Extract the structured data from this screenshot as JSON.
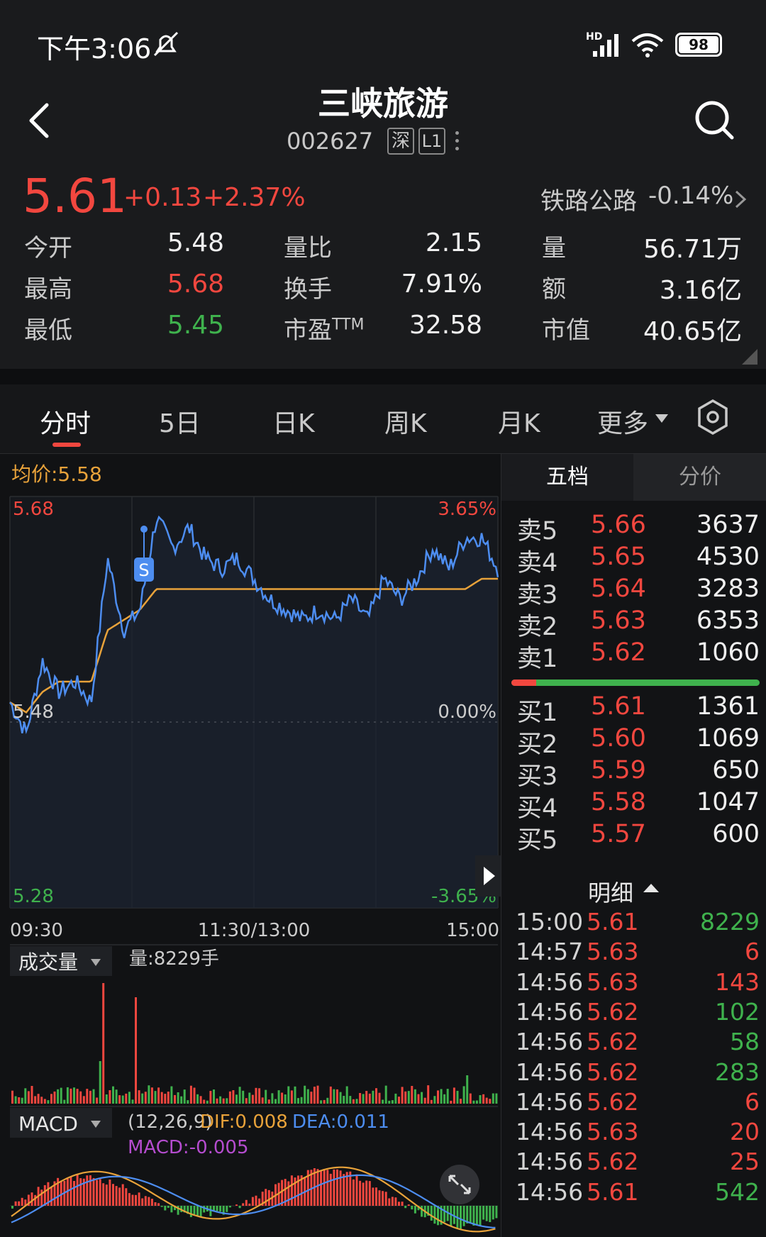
{
  "status": {
    "time": "下午3:06",
    "battery": "98",
    "network": "HD"
  },
  "stock": {
    "name": "三峡旅游",
    "code": "002627",
    "market": "深",
    "level": "L1",
    "price": "5.61",
    "change": "+0.13",
    "change_pct": "+2.37%",
    "sector": "铁路公路",
    "sector_pct": "-0.14%"
  },
  "stats": {
    "open_label": "今开",
    "open": "5.48",
    "high_label": "最高",
    "high": "5.68",
    "low_label": "最低",
    "low": "5.45",
    "vr_label": "量比",
    "vr": "2.15",
    "turn_label": "换手",
    "turn": "7.91%",
    "pe_label": "市盈",
    "pe_sup": "TTM",
    "pe": "32.58",
    "vol_label": "量",
    "vol": "56.71万",
    "amt_label": "额",
    "amt": "3.16亿",
    "mcap_label": "市值",
    "mcap": "40.65亿"
  },
  "tabs": [
    "分时",
    "5日",
    "日K",
    "周K",
    "月K",
    "更多"
  ],
  "chart": {
    "avg_label": "均价:5.58",
    "y_top": "5.68",
    "y_mid": "5.48",
    "y_bot": "5.28",
    "pct_top": "3.65%",
    "pct_mid": "0.00%",
    "pct_bot": "-3.65%",
    "x_start": "09:30",
    "x_mid": "11:30/13:00",
    "x_end": "15:00",
    "marker": "S",
    "vol_selector": "成交量",
    "vol_info": "量:8229手",
    "macd_selector": "MACD",
    "macd_params": "(12,26,9)",
    "dif": "DIF:0.008",
    "dea": "DEA:0.011",
    "macd": "MACD:-0.005"
  },
  "chart_data": {
    "type": "line",
    "title": "",
    "x": [
      "09:30",
      "11:30/13:00",
      "15:00"
    ],
    "ylim": [
      5.28,
      5.68
    ],
    "series": [
      {
        "name": "",
        "values": [
          5.48,
          5.45,
          5.52,
          5.49,
          5.5,
          5.48,
          5.62,
          5.55,
          5.57,
          5.66,
          5.63,
          5.65,
          5.62,
          5.61,
          5.62,
          5.6,
          5.58,
          5.57,
          5.56,
          5.57,
          5.56,
          5.58,
          5.56,
          5.6,
          5.58,
          5.6,
          5.63,
          5.61,
          5.64,
          5.64,
          5.61
        ]
      },
      {
        "name": "均价",
        "values": [
          5.48,
          5.47,
          5.49,
          5.5,
          5.5,
          5.5,
          5.55,
          5.56,
          5.57,
          5.59,
          5.59,
          5.59,
          5.59,
          5.59,
          5.59,
          5.59,
          5.59,
          5.59,
          5.59,
          5.59,
          5.59,
          5.59,
          5.59,
          5.59,
          5.59,
          5.59,
          5.59,
          5.59,
          5.59,
          5.6,
          5.6
        ]
      }
    ]
  },
  "orderbook": {
    "tab_active": "五档",
    "tab_other": "分价",
    "sells": [
      {
        "label": "卖5",
        "price": "5.66",
        "vol": "3637"
      },
      {
        "label": "卖4",
        "price": "5.65",
        "vol": "4530"
      },
      {
        "label": "卖3",
        "price": "5.64",
        "vol": "3283"
      },
      {
        "label": "卖2",
        "price": "5.63",
        "vol": "6353"
      },
      {
        "label": "卖1",
        "price": "5.62",
        "vol": "1060"
      }
    ],
    "buys": [
      {
        "label": "买1",
        "price": "5.61",
        "vol": "1361"
      },
      {
        "label": "买2",
        "price": "5.60",
        "vol": "1069"
      },
      {
        "label": "买3",
        "price": "5.59",
        "vol": "650"
      },
      {
        "label": "买4",
        "price": "5.58",
        "vol": "1047"
      },
      {
        "label": "买5",
        "price": "5.57",
        "vol": "600"
      }
    ],
    "buy_ratio": 0.1
  },
  "ticks": {
    "title": "明细",
    "rows": [
      {
        "time": "15:00",
        "price": "5.61",
        "vol": "8229",
        "side": "buy"
      },
      {
        "time": "14:57",
        "price": "5.63",
        "vol": "6",
        "side": "sell"
      },
      {
        "time": "14:56",
        "price": "5.63",
        "vol": "143",
        "side": "sell"
      },
      {
        "time": "14:56",
        "price": "5.62",
        "vol": "102",
        "side": "buy"
      },
      {
        "time": "14:56",
        "price": "5.62",
        "vol": "58",
        "side": "buy"
      },
      {
        "time": "14:56",
        "price": "5.62",
        "vol": "283",
        "side": "buy"
      },
      {
        "time": "14:56",
        "price": "5.62",
        "vol": "6",
        "side": "sell"
      },
      {
        "time": "14:56",
        "price": "5.63",
        "vol": "20",
        "side": "sell"
      },
      {
        "time": "14:56",
        "price": "5.62",
        "vol": "25",
        "side": "sell"
      },
      {
        "time": "14:56",
        "price": "5.61",
        "vol": "542",
        "side": "buy"
      }
    ]
  },
  "colors": {
    "up": "#f2473f",
    "down": "#3fb24d",
    "avg": "#e8a23a",
    "price": "#4d8df0",
    "macd": "#b54ccf"
  }
}
